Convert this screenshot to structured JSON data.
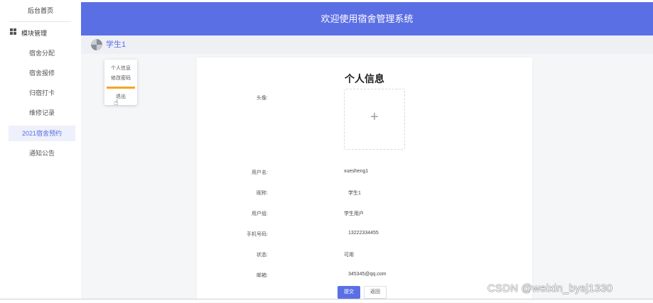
{
  "sidebar": {
    "title": "后台首页",
    "manage_label": "模块管理",
    "items": [
      {
        "label": "宿舍分配"
      },
      {
        "label": "宿舍报修"
      },
      {
        "label": "归宿打卡"
      },
      {
        "label": "维修记录"
      },
      {
        "label": "2021宿舍预约"
      },
      {
        "label": "通知公告"
      }
    ],
    "active_index": 4
  },
  "header": {
    "title": "欢迎使用宿舍管理系统"
  },
  "user": {
    "name": "学生1"
  },
  "dropdown": {
    "items": [
      {
        "label": "个人信息"
      },
      {
        "label": "修改密码"
      },
      {
        "label": "退出"
      }
    ]
  },
  "profile": {
    "title": "个人信息",
    "avatar_label": "头像:",
    "upload_plus": "+",
    "fields": [
      {
        "label": "用户名:",
        "value": "xuesheng1"
      },
      {
        "label": "昵称:",
        "value": "学生1"
      },
      {
        "label": "用户组:",
        "value": "学生用户"
      },
      {
        "label": "手机号码:",
        "value": "13222334455"
      },
      {
        "label": "状态:",
        "value": "可用"
      },
      {
        "label": "邮箱:",
        "value": "345345@qq.com"
      }
    ],
    "submit_label": "提交",
    "reset_label": "返回"
  },
  "watermark": "CSDN @weixin_bysj1330",
  "colors": {
    "primary": "#5b6fe5",
    "accent": "#f5a623",
    "active_bg": "#eef1fb"
  }
}
